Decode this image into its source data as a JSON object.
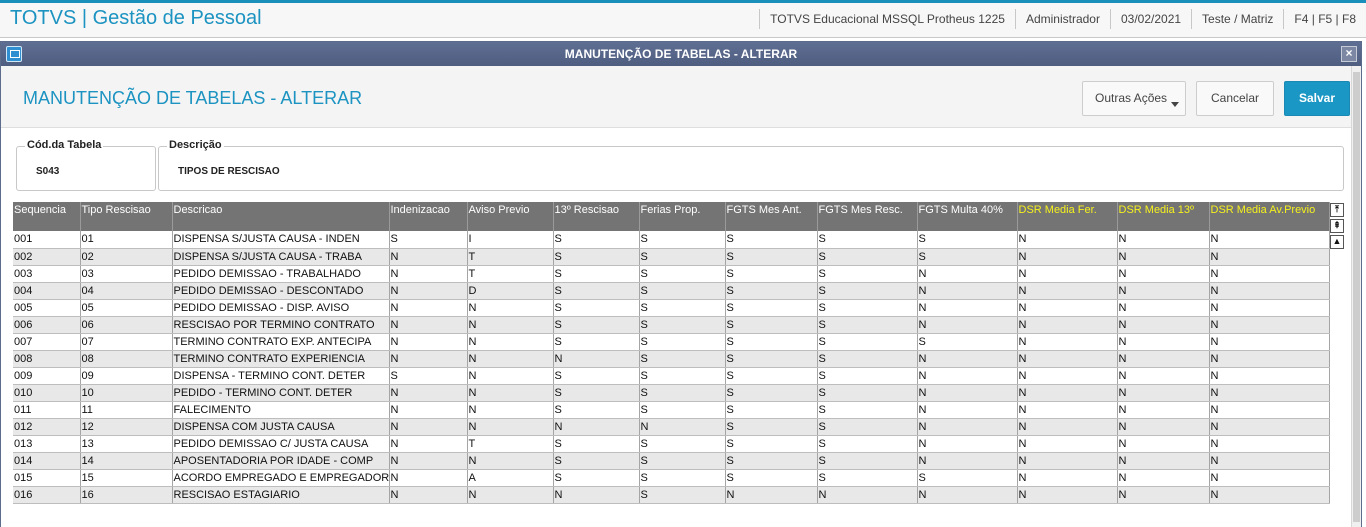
{
  "app": {
    "title": "TOTVS | Gestão de Pessoal",
    "environment": "TOTVS Educacional MSSQL Protheus 1225",
    "user": "Administrador",
    "date": "03/02/2021",
    "branch": "Teste / Matriz",
    "shortcuts": "F4 | F5 | F8"
  },
  "dialog": {
    "title": "MANUTENÇÃO DE TABELAS - ALTERAR",
    "close_label": "×"
  },
  "header": {
    "page_title": "MANUTENÇÃO DE TABELAS - ALTERAR",
    "more_actions_label": "Outras Ações",
    "cancel_label": "Cancelar",
    "save_label": "Salvar"
  },
  "form": {
    "code_label": "Cód.da Tabela",
    "code_value": "S043",
    "description_label": "Descrição",
    "description_value": "TIPOS DE RESCISAO"
  },
  "grid": {
    "columns": [
      "Sequencia",
      "Tipo Rescisao",
      "Descricao",
      "Indenizacao",
      "Aviso Previo",
      "13º Rescisao",
      "Ferias Prop.",
      "FGTS Mes Ant.",
      "FGTS Mes Resc.",
      "FGTS Multa 40%",
      "DSR Media Fer.",
      "DSR Media 13º",
      "DSR Media Av.Previo"
    ],
    "highlight_color": "#f6f21c",
    "rows": [
      [
        "001",
        "01",
        "DISPENSA S/JUSTA CAUSA - INDEN",
        "S",
        "I",
        "S",
        "S",
        "S",
        "S",
        "S",
        "N",
        "N",
        "N"
      ],
      [
        "002",
        "02",
        "DISPENSA S/JUSTA CAUSA - TRABA",
        "N",
        "T",
        "S",
        "S",
        "S",
        "S",
        "S",
        "N",
        "N",
        "N"
      ],
      [
        "003",
        "03",
        "PEDIDO DEMISSAO - TRABALHADO",
        "N",
        "T",
        "S",
        "S",
        "S",
        "S",
        "N",
        "N",
        "N",
        "N"
      ],
      [
        "004",
        "04",
        "PEDIDO DEMISSAO - DESCONTADO",
        "N",
        "D",
        "S",
        "S",
        "S",
        "S",
        "N",
        "N",
        "N",
        "N"
      ],
      [
        "005",
        "05",
        "PEDIDO DEMISSAO - DISP. AVISO",
        "N",
        "N",
        "S",
        "S",
        "S",
        "S",
        "N",
        "N",
        "N",
        "N"
      ],
      [
        "006",
        "06",
        "RESCISAO POR TERMINO CONTRATO",
        "N",
        "N",
        "S",
        "S",
        "S",
        "S",
        "N",
        "N",
        "N",
        "N"
      ],
      [
        "007",
        "07",
        "TERMINO CONTRATO EXP. ANTECIPA",
        "N",
        "N",
        "S",
        "S",
        "S",
        "S",
        "S",
        "N",
        "N",
        "N"
      ],
      [
        "008",
        "08",
        "TERMINO CONTRATO EXPERIENCIA",
        "N",
        "N",
        "N",
        "S",
        "S",
        "S",
        "N",
        "N",
        "N",
        "N"
      ],
      [
        "009",
        "09",
        "DISPENSA - TERMINO CONT. DETER",
        "S",
        "N",
        "S",
        "S",
        "S",
        "S",
        "N",
        "N",
        "N",
        "N"
      ],
      [
        "010",
        "10",
        "PEDIDO - TERMINO CONT. DETER",
        "N",
        "N",
        "S",
        "S",
        "S",
        "S",
        "N",
        "N",
        "N",
        "N"
      ],
      [
        "011",
        "11",
        "FALECIMENTO",
        "N",
        "N",
        "S",
        "S",
        "S",
        "S",
        "N",
        "N",
        "N",
        "N"
      ],
      [
        "012",
        "12",
        "DISPENSA COM JUSTA CAUSA",
        "N",
        "N",
        "N",
        "N",
        "S",
        "S",
        "N",
        "N",
        "N",
        "N"
      ],
      [
        "013",
        "13",
        "PEDIDO DEMISSAO C/ JUSTA CAUSA",
        "N",
        "T",
        "S",
        "S",
        "S",
        "S",
        "N",
        "N",
        "N",
        "N"
      ],
      [
        "014",
        "14",
        "APOSENTADORIA POR IDADE - COMP",
        "N",
        "N",
        "S",
        "S",
        "S",
        "S",
        "N",
        "N",
        "N",
        "N"
      ],
      [
        "015",
        "15",
        "ACORDO EMPREGADO E EMPREGADOR",
        "N",
        "A",
        "S",
        "S",
        "S",
        "S",
        "S",
        "N",
        "N",
        "N"
      ],
      [
        "016",
        "16",
        "RESCISAO ESTAGIARIO",
        "N",
        "N",
        "N",
        "S",
        "N",
        "N",
        "N",
        "N",
        "N",
        "N"
      ]
    ]
  }
}
